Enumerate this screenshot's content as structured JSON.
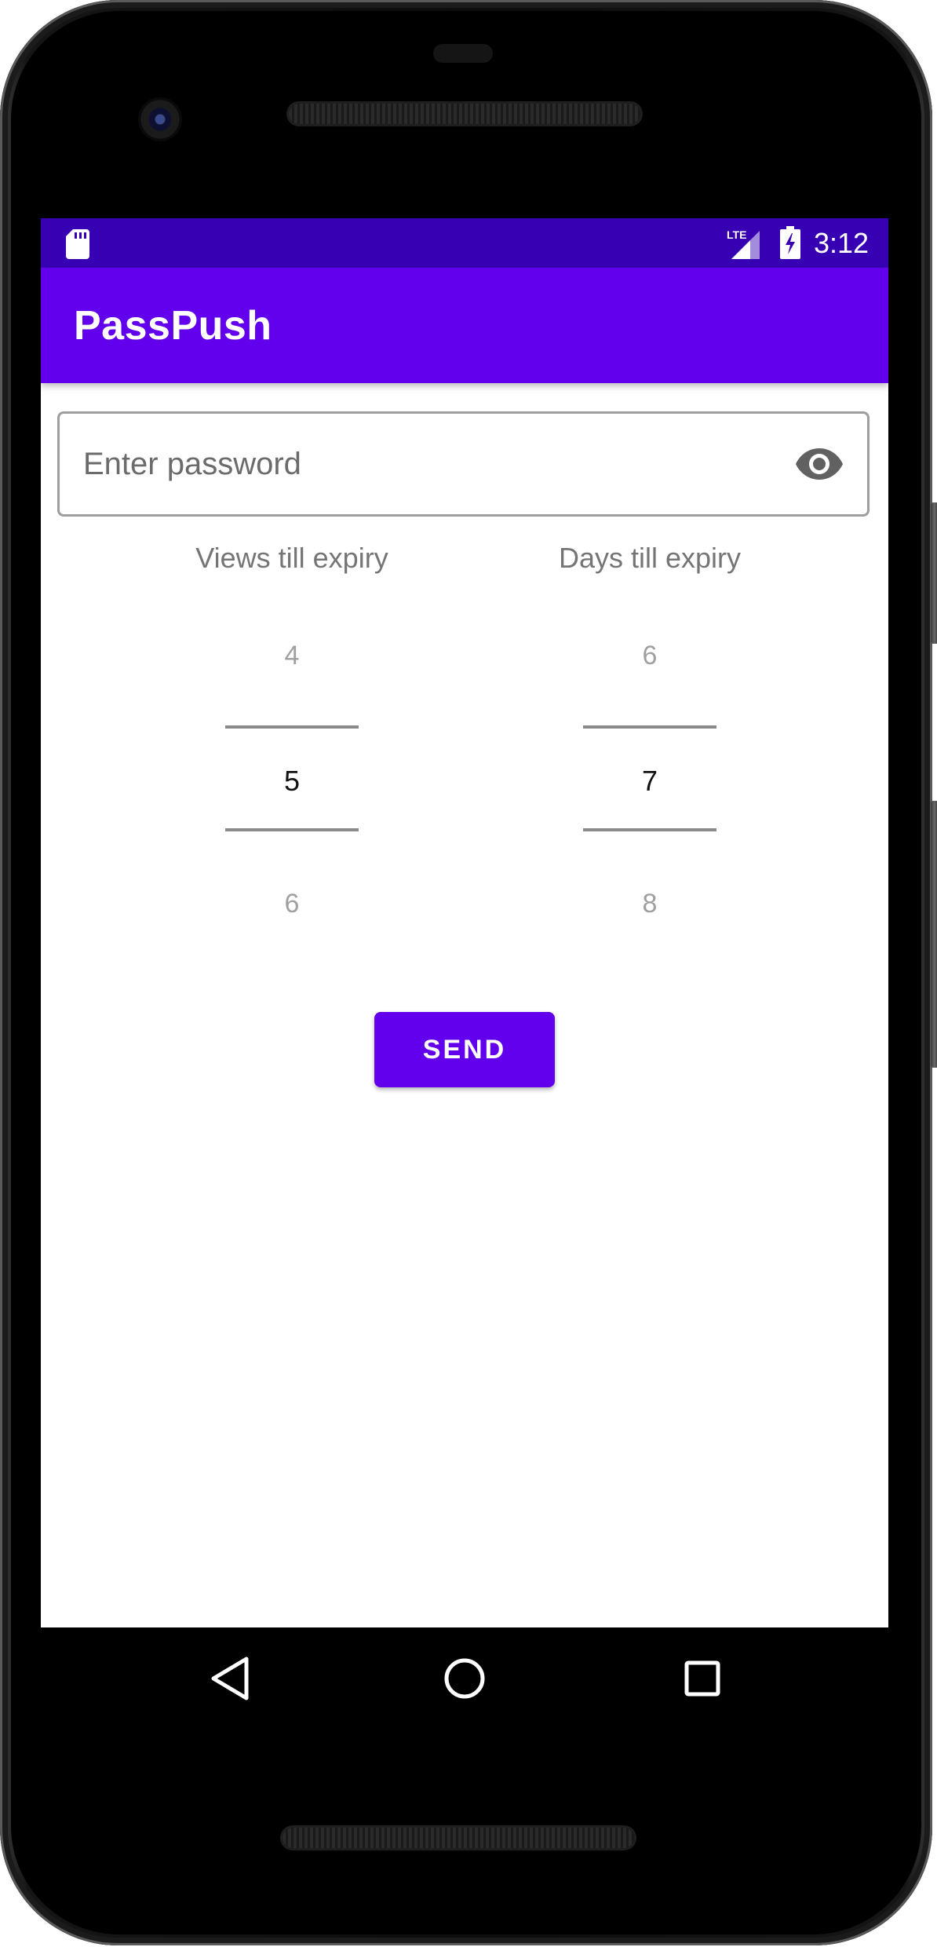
{
  "status_bar": {
    "time": "3:12",
    "network": "LTE",
    "icons": [
      "sd-card-icon",
      "lte-signal-icon",
      "battery-charging-icon"
    ]
  },
  "app_bar": {
    "title": "PassPush"
  },
  "password_field": {
    "placeholder": "Enter password",
    "value": "",
    "toggle_icon": "eye-icon"
  },
  "views_picker": {
    "label": "Views till expiry",
    "prev": "4",
    "selected": "5",
    "next": "6"
  },
  "days_picker": {
    "label": "Days till expiry",
    "prev": "6",
    "selected": "7",
    "next": "8"
  },
  "send_button": {
    "label": "SEND"
  },
  "nav_bar": {
    "icons": [
      "back-icon",
      "home-icon",
      "recents-icon"
    ]
  },
  "colors": {
    "primary": "#6200ee",
    "primary_dark": "#3700b3",
    "on_primary": "#ffffff"
  }
}
